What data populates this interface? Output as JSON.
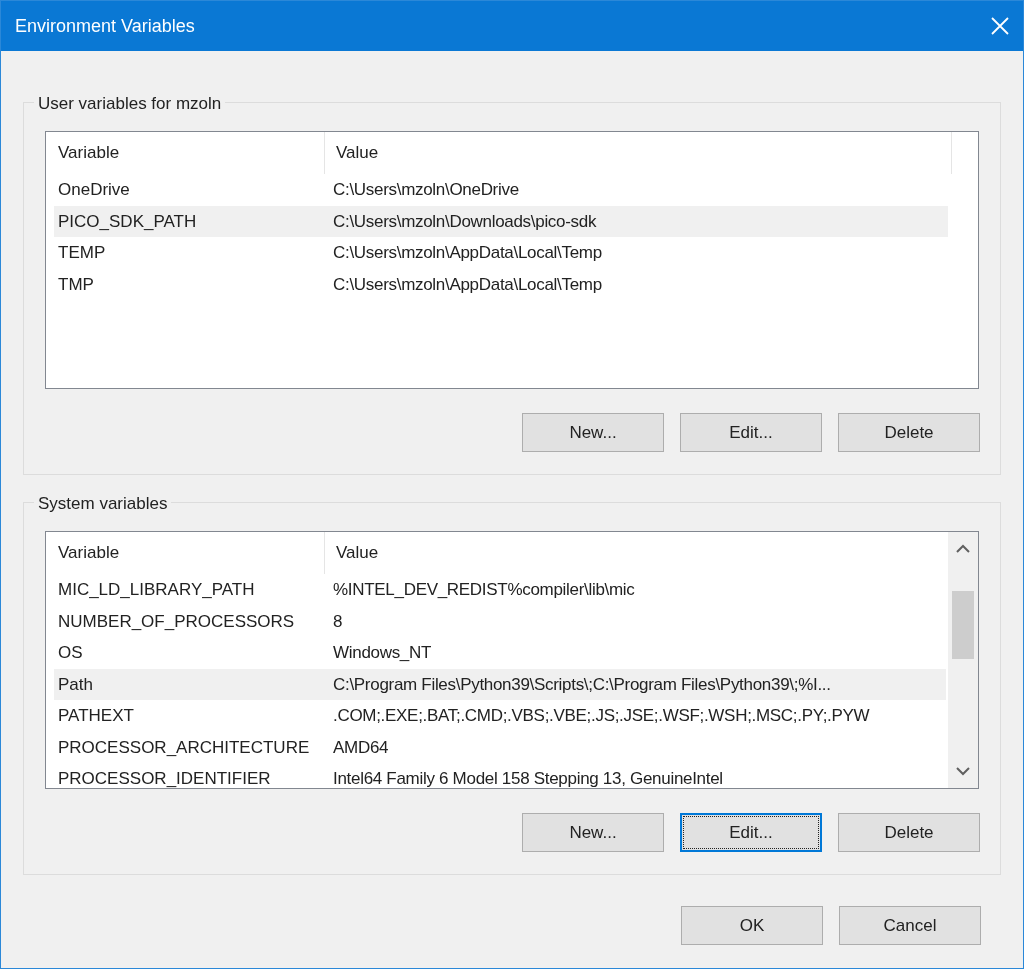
{
  "window": {
    "title": "Environment Variables"
  },
  "groups": [
    {
      "title": "User variables for mzoln",
      "scrollable": false,
      "columns": [
        "Variable",
        "Value"
      ],
      "rows": [
        {
          "variable": "OneDrive",
          "value": "C:\\Users\\mzoln\\OneDrive",
          "selected": false
        },
        {
          "variable": "PICO_SDK_PATH",
          "value": "C:\\Users\\mzoln\\Downloads\\pico-sdk",
          "selected": true
        },
        {
          "variable": "TEMP",
          "value": "C:\\Users\\mzoln\\AppData\\Local\\Temp",
          "selected": false
        },
        {
          "variable": "TMP",
          "value": "C:\\Users\\mzoln\\AppData\\Local\\Temp",
          "selected": false
        }
      ],
      "buttons": [
        {
          "label": "New...",
          "focused": false
        },
        {
          "label": "Edit...",
          "focused": false
        },
        {
          "label": "Delete",
          "focused": false
        }
      ]
    },
    {
      "title": "System variables",
      "scrollable": true,
      "columns": [
        "Variable",
        "Value"
      ],
      "rows": [
        {
          "variable": "MIC_LD_LIBRARY_PATH",
          "value": "%INTEL_DEV_REDIST%compiler\\lib\\mic",
          "selected": false
        },
        {
          "variable": "NUMBER_OF_PROCESSORS",
          "value": "8",
          "selected": false
        },
        {
          "variable": "OS",
          "value": "Windows_NT",
          "selected": false
        },
        {
          "variable": "Path",
          "value": "C:\\Program Files\\Python39\\Scripts\\;C:\\Program Files\\Python39\\;%I...",
          "selected": true
        },
        {
          "variable": "PATHEXT",
          "value": ".COM;.EXE;.BAT;.CMD;.VBS;.VBE;.JS;.JSE;.WSF;.WSH;.MSC;.PY;.PYW",
          "selected": false
        },
        {
          "variable": "PROCESSOR_ARCHITECTURE",
          "value": "AMD64",
          "selected": false
        },
        {
          "variable": "PROCESSOR_IDENTIFIER",
          "value": "Intel64 Family 6 Model 158 Stepping 13, GenuineIntel",
          "selected": false
        }
      ],
      "buttons": [
        {
          "label": "New...",
          "focused": false
        },
        {
          "label": "Edit...",
          "focused": true
        },
        {
          "label": "Delete",
          "focused": false
        }
      ]
    }
  ],
  "footer_buttons": [
    {
      "label": "OK"
    },
    {
      "label": "Cancel"
    }
  ]
}
